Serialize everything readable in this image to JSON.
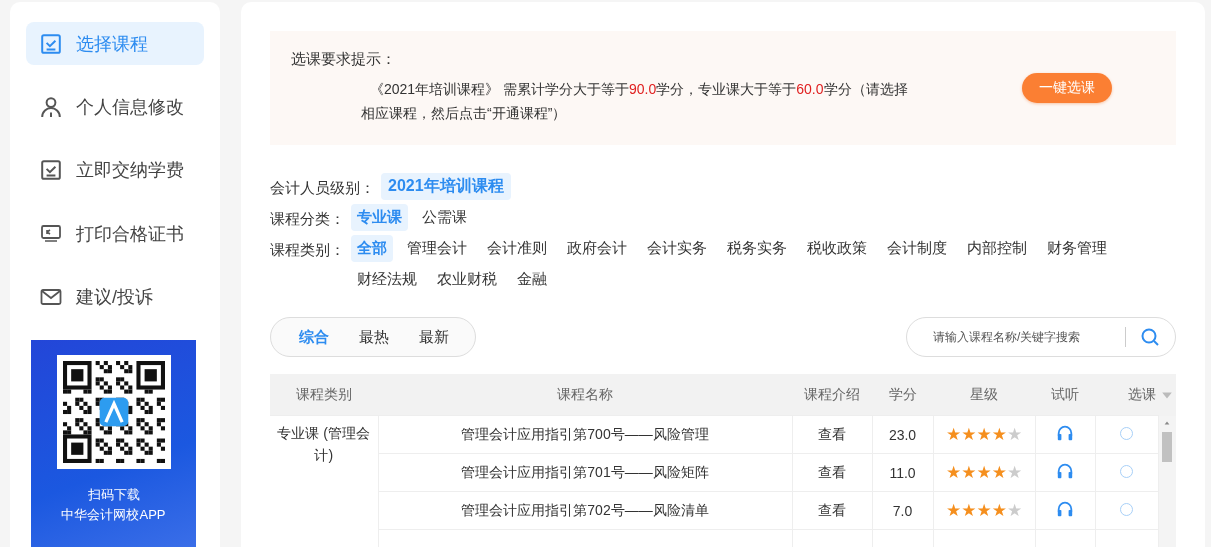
{
  "sidebar": {
    "items": [
      {
        "label": "选择课程",
        "selected": true
      },
      {
        "label": "个人信息修改",
        "selected": false
      },
      {
        "label": "立即交纳学费",
        "selected": false
      },
      {
        "label": "打印合格证书",
        "selected": false
      },
      {
        "label": "建议/投诉",
        "selected": false
      }
    ],
    "app_promo": {
      "line_1": "扫码下载",
      "line_2": "中华会计网校APP"
    }
  },
  "notice": {
    "title": "选课要求提示：",
    "parts": [
      {
        "text": "《2021年培训课程》 需累计学分大于等于",
        "highlight": false
      },
      {
        "text": "90.0",
        "highlight": true
      },
      {
        "text": "学分，专业课大于等于",
        "highlight": false
      },
      {
        "text": "60.0",
        "highlight": true
      },
      {
        "text": "学分（请选择相应课程，然后点击“开通课程”）",
        "highlight": false
      }
    ],
    "button": "一键选课"
  },
  "filters": [
    {
      "label": "会计人员级别：",
      "options": [
        {
          "text": "2021年培训课程",
          "selected": true
        }
      ]
    },
    {
      "label": "课程分类：",
      "options": [
        {
          "text": "专业课",
          "selected": true
        },
        {
          "text": "公需课",
          "selected": false
        }
      ]
    },
    {
      "label": "课程类别：",
      "options": [
        {
          "text": "全部",
          "selected": true
        },
        {
          "text": "管理会计",
          "selected": false
        },
        {
          "text": "会计准则",
          "selected": false
        },
        {
          "text": "政府会计",
          "selected": false
        },
        {
          "text": "会计实务",
          "selected": false
        },
        {
          "text": "税务实务",
          "selected": false
        },
        {
          "text": "税收政策",
          "selected": false
        },
        {
          "text": "会计制度",
          "selected": false
        },
        {
          "text": "内部控制",
          "selected": false
        },
        {
          "text": "财务管理",
          "selected": false
        },
        {
          "text": "财经法规",
          "selected": false
        },
        {
          "text": "农业财税",
          "selected": false
        },
        {
          "text": "金融",
          "selected": false
        }
      ]
    }
  ],
  "sort_tabs": [
    {
      "label": "综合",
      "selected": true
    },
    {
      "label": "最热",
      "selected": false
    },
    {
      "label": "最新",
      "selected": false
    }
  ],
  "search": {
    "placeholder": "请输入课程名称/关键字搜索"
  },
  "table": {
    "columns": [
      "课程类别",
      "课程名称",
      "课程介绍",
      "学分",
      "星级",
      "试听",
      "选课"
    ],
    "category": "专业课 (管理会计)",
    "rows": [
      {
        "name": "管理会计应用指引第700号——风险管理",
        "intro": "查看",
        "credit": "23.0",
        "stars": 4,
        "selected": false
      },
      {
        "name": "管理会计应用指引第701号——风险矩阵",
        "intro": "查看",
        "credit": "11.0",
        "stars": 4,
        "selected": false
      },
      {
        "name": "管理会计应用指引第702号——风险清单",
        "intro": "查看",
        "credit": "7.0",
        "stars": 4,
        "selected": false
      }
    ]
  }
}
